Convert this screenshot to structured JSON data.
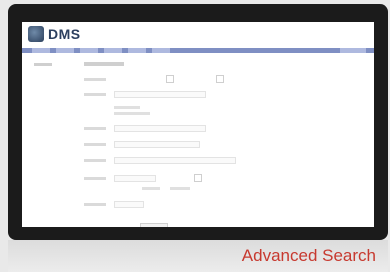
{
  "app": {
    "logo_text": "DMS",
    "caption": "Advanced Search"
  }
}
